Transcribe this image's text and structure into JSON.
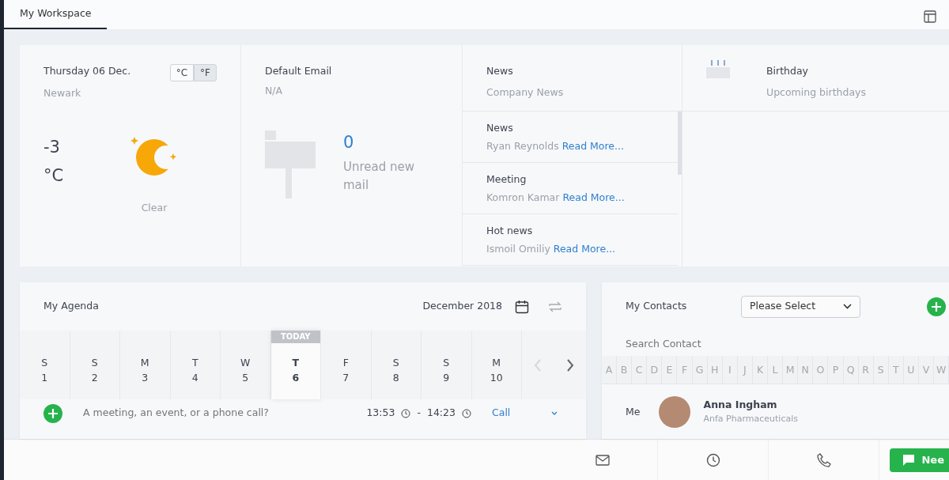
{
  "tabs": [
    {
      "label": "My Workspace",
      "selected": true
    }
  ],
  "weather": {
    "date": "Thursday 06 Dec.",
    "city": "Newark",
    "units": [
      {
        "label": "°C",
        "selected": false
      },
      {
        "label": "°F",
        "selected": true
      }
    ],
    "temperature": "-3",
    "unit": "°C",
    "condition": "Clear"
  },
  "email": {
    "title": "Default Email",
    "account": "N/A",
    "count": "0",
    "caption": "Unread new mail"
  },
  "news": {
    "title": "News",
    "subtitle": "Company News",
    "items": [
      {
        "title": "News",
        "author": "Ryan Reynolds",
        "link": "Read More..."
      },
      {
        "title": "Meeting",
        "author": "Komron Kamar",
        "link": "Read More..."
      },
      {
        "title": "Hot news",
        "author": "Ismoil Omiliy",
        "link": "Read More..."
      }
    ]
  },
  "birthday": {
    "title": "Birthday",
    "subtitle": "Upcoming birthdays"
  },
  "agenda": {
    "title": "My Agenda",
    "month": "December 2018",
    "today_label": "TODAY",
    "days": [
      {
        "weekday": "S",
        "date": "1",
        "selected": false
      },
      {
        "weekday": "S",
        "date": "2",
        "selected": false
      },
      {
        "weekday": "M",
        "date": "3",
        "selected": false
      },
      {
        "weekday": "T",
        "date": "4",
        "selected": false
      },
      {
        "weekday": "W",
        "date": "5",
        "selected": false
      },
      {
        "weekday": "T",
        "date": "6",
        "selected": true
      },
      {
        "weekday": "F",
        "date": "7",
        "selected": false
      },
      {
        "weekday": "S",
        "date": "8",
        "selected": false
      },
      {
        "weekday": "S",
        "date": "9",
        "selected": false
      },
      {
        "weekday": "M",
        "date": "10",
        "selected": false
      }
    ],
    "new_event": {
      "placeholder": "A meeting, an event, or a phone call?",
      "start": "13:53",
      "separator": "-",
      "end": "14:23",
      "type": "Call"
    }
  },
  "contacts": {
    "title": "My Contacts",
    "filter": "Please Select",
    "search_placeholder": "Search Contact",
    "letters": [
      "A",
      "B",
      "C",
      "D",
      "E",
      "F",
      "G",
      "H",
      "I",
      "J",
      "K",
      "L",
      "M",
      "N",
      "O",
      "P",
      "Q",
      "R",
      "S",
      "T",
      "U",
      "V",
      "W"
    ],
    "items": [
      {
        "label": "Me",
        "name": "Anna Ingham",
        "company": "Anfa Pharmaceuticals"
      }
    ]
  },
  "footer": {
    "chat_button": "Nee"
  }
}
